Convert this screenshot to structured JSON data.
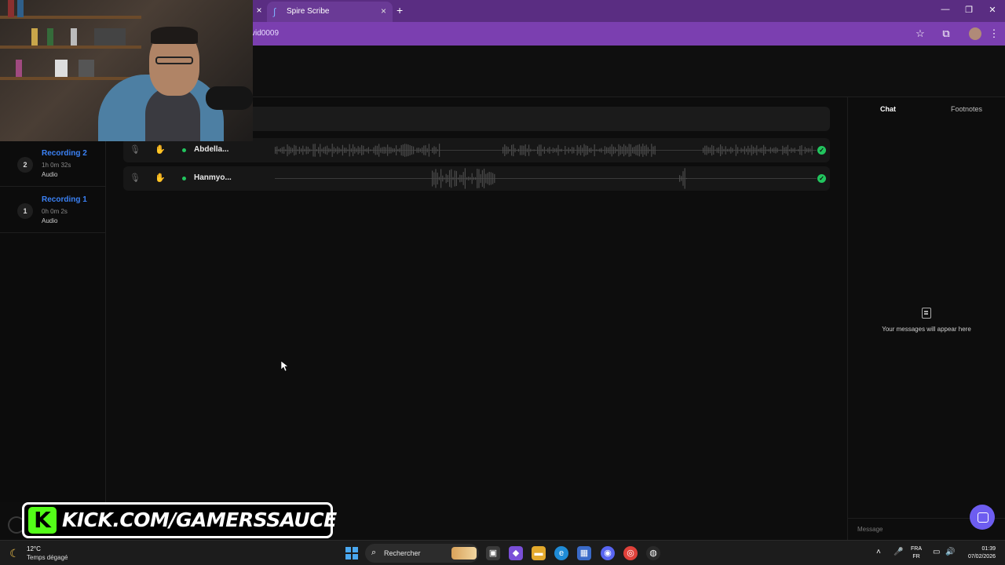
{
  "browser": {
    "tab_title": "Spire Scribe",
    "url_fragment": "vid0009",
    "new_tab": "+",
    "close": "×"
  },
  "sidebar": {
    "recordings": [
      {
        "num": "2",
        "name": "Recording 2",
        "duration": "1h 0m 32s",
        "kind": "Audio"
      },
      {
        "num": "1",
        "name": "Recording 1",
        "duration": "0h 0m 2s",
        "kind": "Audio"
      }
    ]
  },
  "tracks": [
    {
      "name": "Abdella...",
      "status": "ready"
    },
    {
      "name": "Hanmyo...",
      "status": "ready"
    }
  ],
  "right_panel": {
    "tab_chat": "Chat",
    "tab_footnotes": "Footnotes",
    "empty_message": "Your messages will appear here",
    "message_placeholder": "Message"
  },
  "overlay": {
    "kick_text": "KICK.COM/GAMERSSAUCE",
    "kick_letter": "K"
  },
  "taskbar": {
    "temperature": "12°C",
    "weather": "Temps dégagé",
    "search_label": "Rechercher",
    "lang_top": "FRA",
    "lang_bottom": "FR",
    "time": "01:39",
    "date": "07/02/2026"
  },
  "colors": {
    "accent_purple": "#7b3fb0",
    "recording_blue": "#3b82f6",
    "status_green": "#22c55e",
    "kick_green": "#53fc18"
  }
}
